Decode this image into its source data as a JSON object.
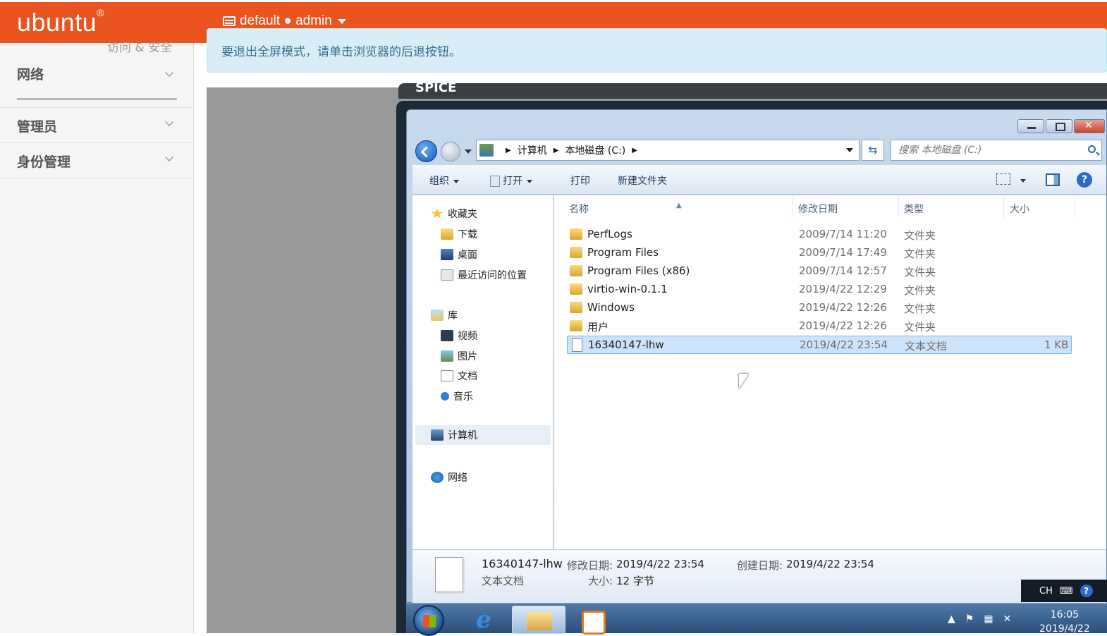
{
  "header": {
    "logo": "ubuntu",
    "logo_mark": "®",
    "project_label": "default ● admin"
  },
  "sidebar": {
    "partial_title": "访问 & 安全",
    "sections": [
      {
        "label": "网络"
      },
      {
        "label": "管理员"
      },
      {
        "label": "身份管理"
      }
    ]
  },
  "alert": {
    "text": "要退出全屏模式，请单击浏览器的后退按钮。"
  },
  "console": {
    "tab_label": "SPICE"
  },
  "explorer": {
    "breadcrumb": [
      "计算机",
      "本地磁盘 (C:)"
    ],
    "search_placeholder": "搜索 本地磁盘 (C:)",
    "refresh_glyph": "⇆",
    "toolbar": {
      "organize": "组织",
      "open": "打开",
      "print": "打印",
      "new_folder": "新建文件夹",
      "help": "?"
    },
    "nav": {
      "favorites": "收藏夹",
      "downloads": "下载",
      "desktop": "桌面",
      "recent": "最近访问的位置",
      "libraries": "库",
      "videos": "视频",
      "pictures": "图片",
      "documents": "文档",
      "music": "音乐",
      "computer": "计算机",
      "network": "网络"
    },
    "columns": {
      "name": "名称",
      "date": "修改日期",
      "type": "类型",
      "size": "大小"
    },
    "files": [
      {
        "name": "PerfLogs",
        "date": "2009/7/14 11:20",
        "type": "文件夹",
        "size": ""
      },
      {
        "name": "Program Files",
        "date": "2009/7/14 17:49",
        "type": "文件夹",
        "size": ""
      },
      {
        "name": "Program Files (x86)",
        "date": "2009/7/14 12:57",
        "type": "文件夹",
        "size": ""
      },
      {
        "name": "virtio-win-0.1.1",
        "date": "2019/4/22 12:29",
        "type": "文件夹",
        "size": ""
      },
      {
        "name": "Windows",
        "date": "2019/4/22 12:26",
        "type": "文件夹",
        "size": ""
      },
      {
        "name": "用户",
        "date": "2019/4/22 12:26",
        "type": "文件夹",
        "size": ""
      },
      {
        "name": "16340147-lhw",
        "date": "2019/4/22 23:54",
        "type": "文本文档",
        "size": "1 KB"
      }
    ],
    "details": {
      "name": "16340147-lhw",
      "type": "文本文档",
      "modified_label": "修改日期:",
      "modified": "2019/4/22 23:54",
      "size_label": "大小:",
      "size": "12 字节",
      "created_label": "创建日期:",
      "created": "2019/4/22 23:54"
    }
  },
  "taskbar": {
    "ie_glyph": "e",
    "lang": "CH",
    "help": "?",
    "time": "16:05",
    "date": "2019/4/22"
  }
}
